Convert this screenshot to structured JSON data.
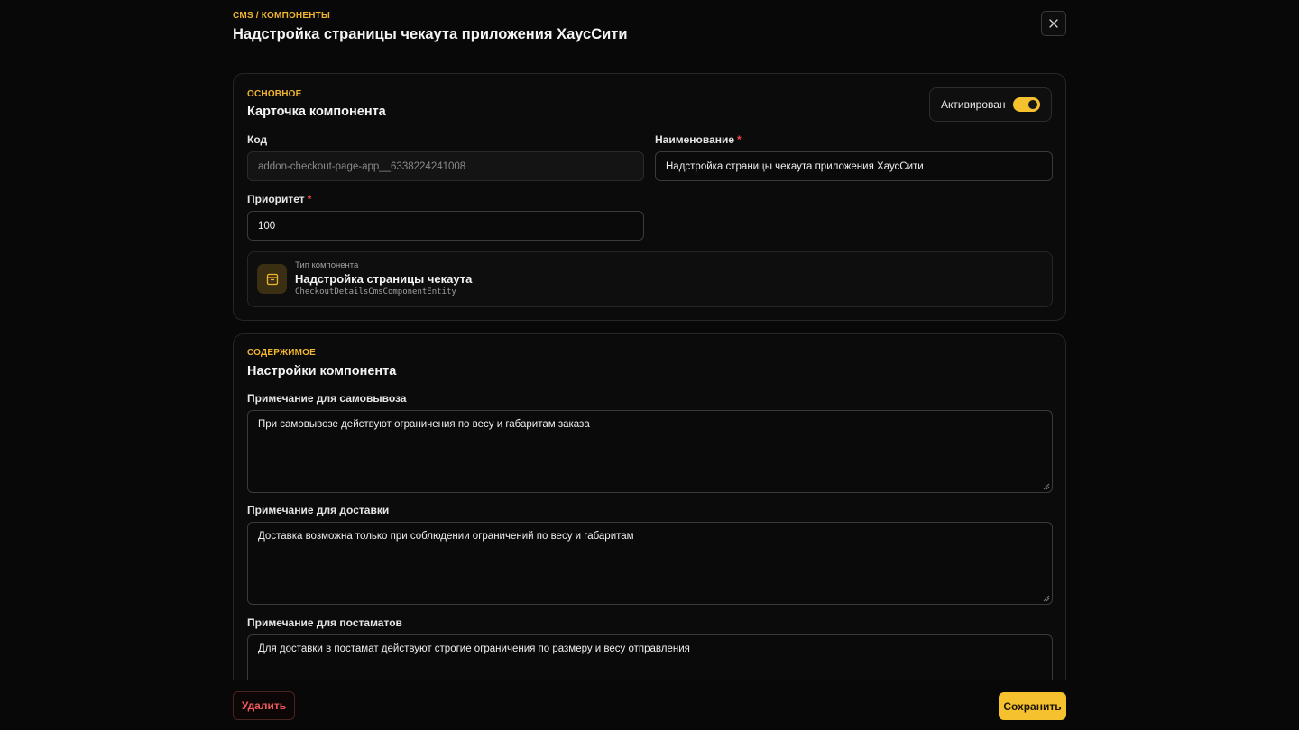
{
  "header": {
    "breadcrumb": "CMS / КОМПОНЕНТЫ",
    "title": "Надстройка страницы чекаута приложения ХаусСити",
    "close_icon": "close-icon"
  },
  "basic": {
    "section_label": "ОСНОВНОЕ",
    "section_title": "Карточка компонента",
    "active_label": "Активирован",
    "active": true,
    "code_label": "Код",
    "code_value": "addon-checkout-page-app__6338224241008",
    "name_label": "Наименование",
    "name_required": "*",
    "name_value": "Надстройка страницы чекаута приложения ХаусСити",
    "priority_label": "Приоритет",
    "priority_required": "*",
    "priority_value": "100",
    "type_caption": "Тип компонента",
    "type_name": "Надстройка страницы чекаута",
    "type_entity": "CheckoutDetailsCmsComponentEntity",
    "type_icon": "box-icon"
  },
  "content": {
    "section_label": "СОДЕРЖИМОЕ",
    "section_title": "Настройки компонента",
    "pickup_label": "Примечание для самовывоза",
    "pickup_value": "При самовывозе действуют ограничения по весу и габаритам заказа",
    "delivery_label": "Примечание для доставки",
    "delivery_value": "Доставка возможна только при соблюдении ограничений по весу и габаритам",
    "postamat_label": "Примечание для постаматов",
    "postamat_value": "Для доставки в постамат действуют строгие ограничения по размеру и весу отправления"
  },
  "footer": {
    "delete_label": "Удалить",
    "save_label": "Сохранить"
  },
  "colors": {
    "accent": "#f5c12e",
    "danger": "#f05a5a",
    "background": "#080808"
  }
}
